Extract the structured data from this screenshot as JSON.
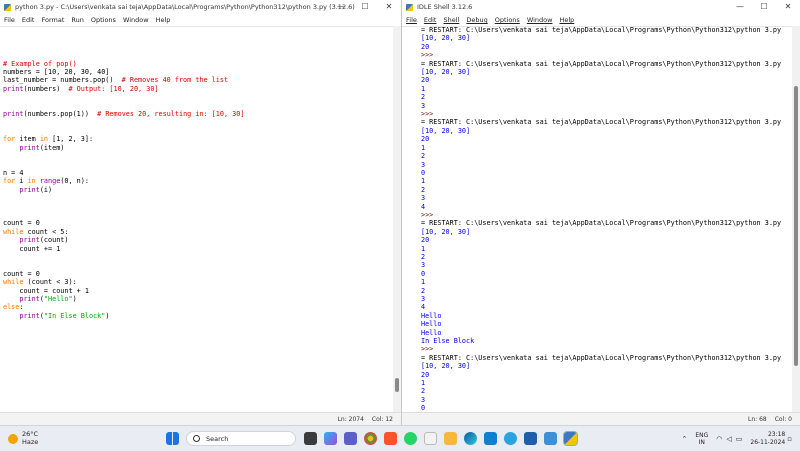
{
  "editor": {
    "title": "python 3.py - C:\\Users\\venkata sai teja\\AppData\\Local\\Programs\\Python\\Python312\\python 3.py (3.12.6)",
    "menu": [
      "File",
      "Edit",
      "Format",
      "Run",
      "Options",
      "Window",
      "Help"
    ],
    "status_ln": "Ln: 2074",
    "status_col": "Col: 12"
  },
  "shell": {
    "title": "IDLE Shell 3.12.6",
    "menu": [
      "File",
      "Edit",
      "Shell",
      "Debug",
      "Options",
      "Window",
      "Help"
    ],
    "status_ln": "Ln: 68",
    "status_col": "Col: 0"
  },
  "taskbar": {
    "temp": "26°C",
    "weather": "Haze",
    "search_placeholder": "Search",
    "lang1": "ENG",
    "lang2": "IN",
    "time": "23:18",
    "date": "26-11-2024"
  },
  "colors": {
    "keyword": "#ff7700",
    "builtin": "#900090",
    "string": "#00aa00",
    "comment": "#dd0000",
    "output": "#0000ff"
  }
}
